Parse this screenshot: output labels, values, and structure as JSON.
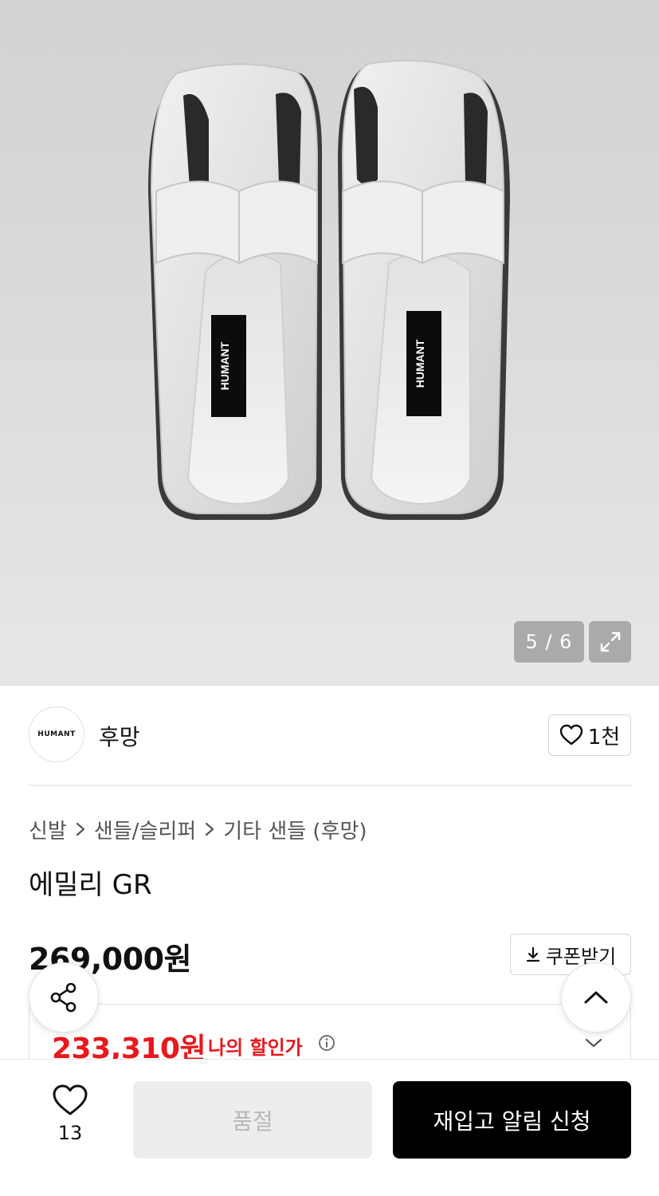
{
  "gallery": {
    "image_alt": "HUMANT",
    "counter": "5 / 6",
    "current_index": 5,
    "total_images": 6
  },
  "brand": {
    "logo_text": "HUMANT",
    "name": "후망",
    "like_count": "1천"
  },
  "breadcrumb": [
    "신발",
    "샌들/슬리퍼",
    "기타 샌들 (후망)"
  ],
  "product": {
    "title": "에밀리 GR",
    "price": "269,000원",
    "sale_price": "233,310원",
    "sale_label": "나의 할인가"
  },
  "actions": {
    "coupon_label": "쿠폰받기",
    "wish_count": "13",
    "soldout_label": "품절",
    "restock_label": "재입고 알림 신청"
  },
  "colors": {
    "accent_red": "#e8181d",
    "primary_black": "#000000",
    "disabled_gray": "#ededed"
  },
  "icons": {
    "expand": "expand-icon",
    "heart": "heart-icon",
    "download": "download-icon",
    "share": "share-icon",
    "arrow_up": "chevron-up-icon",
    "arrow_down": "chevron-down-icon",
    "info": "info-icon",
    "breadcrumb_sep": "chevron-right-icon"
  }
}
